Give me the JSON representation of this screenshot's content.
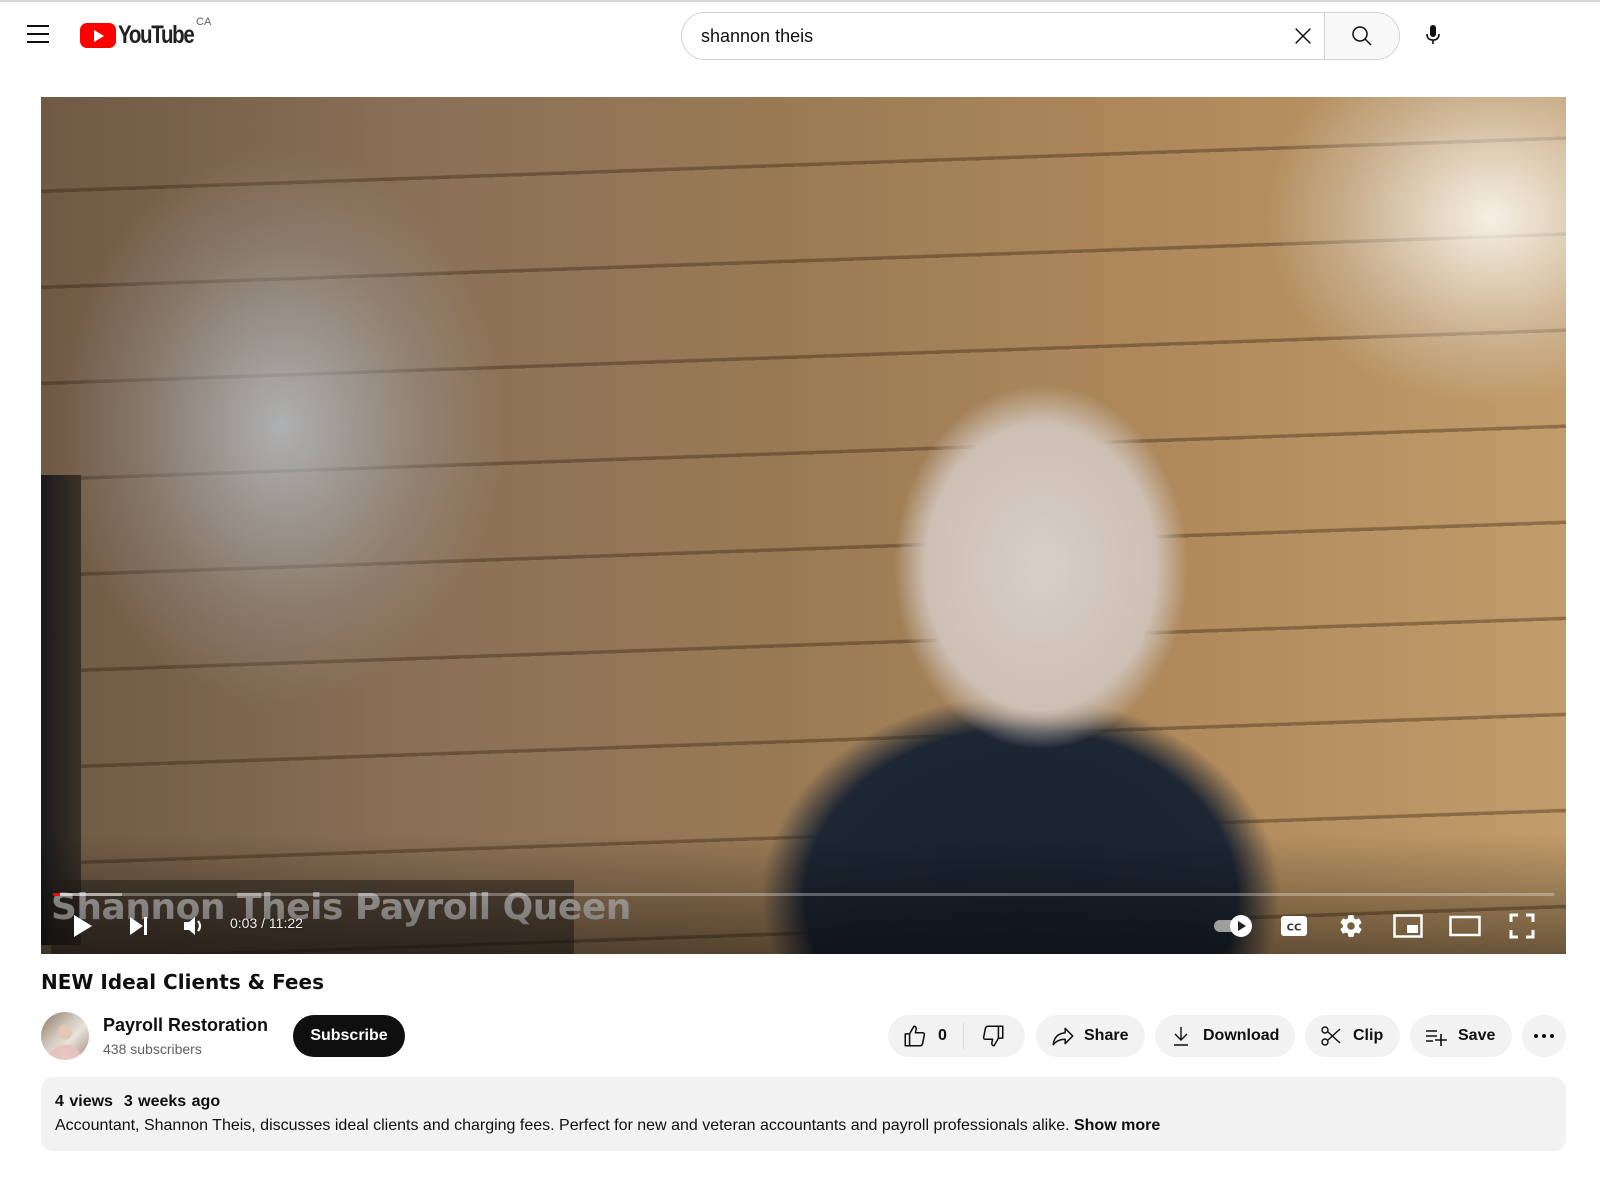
{
  "masthead": {
    "logo_text": "YouTube",
    "region": "CA",
    "search": {
      "value": "shannon theis",
      "placeholder": "Search"
    },
    "icons": {
      "menu": "hamburger-menu-icon",
      "clear": "close-icon",
      "search": "search-icon",
      "mic": "microphone-icon"
    }
  },
  "player": {
    "caption_overlay": "Shannon Theis Payroll Queen",
    "current_time": "0:03",
    "duration": "11:22",
    "time_display": "0:03 / 11:22",
    "progress_played_fraction": 0.0044,
    "progress_buffered_fraction": 0.046,
    "autoplay_on": true,
    "controls": [
      "play",
      "next",
      "volume",
      "autoplay",
      "subtitles",
      "settings",
      "miniplayer",
      "theater-mode",
      "fullscreen"
    ],
    "accent_color": "#ff0000"
  },
  "video": {
    "title": "NEW Ideal Clients & Fees"
  },
  "channel": {
    "name": "Payroll Restoration",
    "subscribers": "438 subscribers",
    "subscribe_label": "Subscribe"
  },
  "actions": {
    "like_count": "0",
    "share_label": "Share",
    "download_label": "Download",
    "clip_label": "Clip",
    "save_label": "Save",
    "more_label": "More actions"
  },
  "description": {
    "meta": "4 views  3 weeks ago",
    "text": "Accountant, Shannon Theis, discusses ideal clients and charging fees. Perfect for new and veteran accountants and payroll professionals alike.",
    "show_more": "Show more"
  }
}
